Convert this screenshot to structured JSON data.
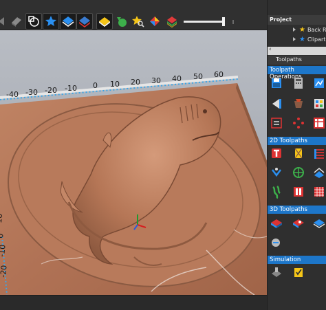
{
  "toolbar": {
    "icons": [
      "view-toggle-icon",
      "select-vectors-icon",
      "node-edit-icon",
      "star-view-icon",
      "layer-blue-icon",
      "layer-red-icon",
      "diamond-yellow-icon",
      "green-circle-icon",
      "star-search-icon",
      "tripod-icon",
      "stripes-icon"
    ],
    "shading_slider": {
      "value": 0.97
    }
  },
  "viewport": {
    "ruler_labels": [
      "-40",
      "-30",
      "-20",
      "-10",
      "0",
      "10",
      "20",
      "30",
      "40",
      "50",
      "60"
    ],
    "side_ruler_labels": [
      "10",
      "0",
      "-10",
      "-20"
    ]
  },
  "project": {
    "header": "Project",
    "items": [
      {
        "label": "Back Re",
        "icon": "star-icon"
      },
      {
        "label": "Clipart",
        "icon": "star-icon"
      }
    ],
    "collapse_label": "‹"
  },
  "toolpaths": {
    "tab_label": "Toolpaths",
    "sections": [
      {
        "title": "Toolpath Operations"
      },
      {
        "title": "2D Toolpaths"
      },
      {
        "title": "3D Toolpaths"
      },
      {
        "title": "Simulation"
      }
    ]
  },
  "colors": {
    "accent": "#1d76c9",
    "wood": "#b5775a",
    "panel": "#2f2f2f"
  }
}
